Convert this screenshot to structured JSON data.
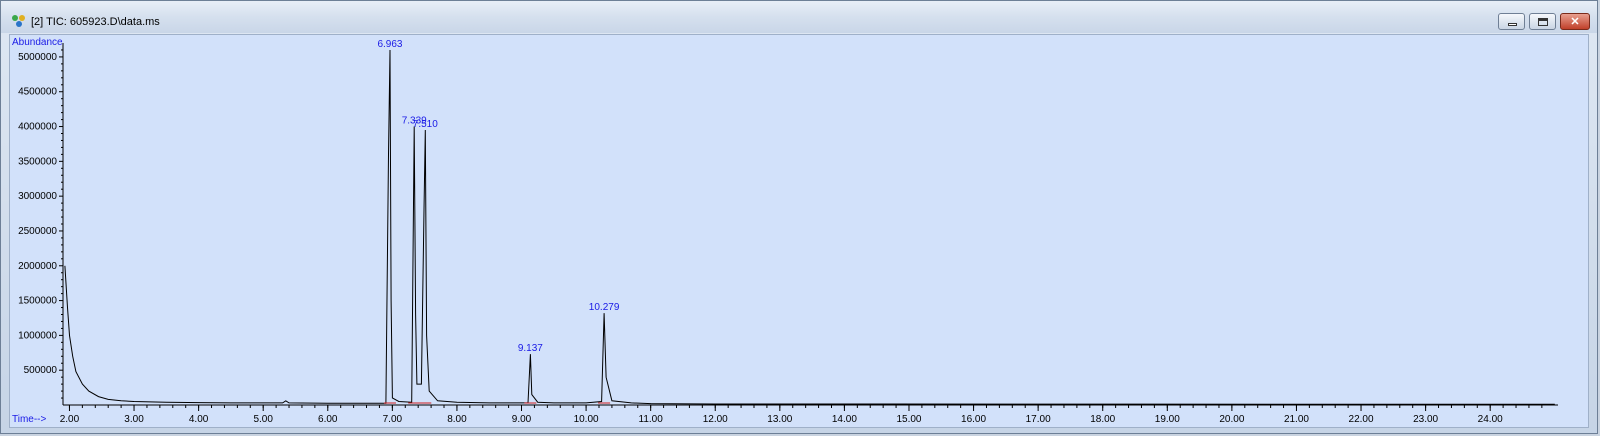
{
  "window": {
    "title": "[2] TIC: 605923.D\\data.ms",
    "icon": "chromatogram-app-icon",
    "buttons": [
      "minimize-icon",
      "maximize-icon",
      "close-icon"
    ]
  },
  "chart_data": {
    "type": "line",
    "title": "",
    "xlabel": "Time-->",
    "ylabel": "Abundance",
    "xlim": [
      1.9,
      25.05
    ],
    "ylim": [
      0,
      5200000
    ],
    "x_ticks": [
      "2.00",
      "3.00",
      "4.00",
      "5.00",
      "6.00",
      "7.00",
      "8.00",
      "9.00",
      "10.00",
      "11.00",
      "12.00",
      "13.00",
      "14.00",
      "15.00",
      "16.00",
      "17.00",
      "18.00",
      "19.00",
      "20.00",
      "21.00",
      "22.00",
      "23.00",
      "24.00"
    ],
    "y_ticks": [
      "500000",
      "1000000",
      "1500000",
      "2000000",
      "2500000",
      "3000000",
      "3500000",
      "4000000",
      "4500000",
      "5000000"
    ],
    "series": [
      {
        "x": [
          1.93,
          1.97,
          2.0,
          2.05,
          2.1,
          2.2,
          2.3,
          2.45,
          2.6,
          2.8,
          3.0,
          3.5,
          4.0,
          4.5,
          5.0,
          5.3,
          5.35,
          5.4,
          6.0,
          6.9,
          6.94,
          6.963,
          6.98,
          7.0,
          7.1,
          7.3,
          7.339,
          7.36,
          7.38,
          7.45,
          7.49,
          7.51,
          7.53,
          7.57,
          7.7,
          8.0,
          8.5,
          9.0,
          9.1,
          9.137,
          9.16,
          9.25,
          9.5,
          10.0,
          10.24,
          10.279,
          10.31,
          10.4,
          10.7,
          11.0,
          12.0,
          25.0
        ],
        "y": [
          2000000,
          1400000,
          1000000,
          700000,
          480000,
          300000,
          200000,
          120000,
          80000,
          60000,
          50000,
          40000,
          35000,
          30000,
          30000,
          30000,
          60000,
          30000,
          25000,
          25000,
          3600000,
          5100000,
          1500000,
          100000,
          50000,
          40000,
          4000000,
          1300000,
          300000,
          300000,
          2800000,
          3950000,
          1000000,
          200000,
          60000,
          40000,
          30000,
          30000,
          30000,
          730000,
          150000,
          40000,
          30000,
          30000,
          50000,
          1320000,
          400000,
          60000,
          30000,
          20000,
          15000,
          10000
        ]
      }
    ],
    "peak_labels": [
      {
        "x": 6.963,
        "y": 5100000,
        "text": "6.963"
      },
      {
        "x": 7.339,
        "y": 4000000,
        "text": "7.339"
      },
      {
        "x": 7.51,
        "y": 3950000,
        "text": "7.510"
      },
      {
        "x": 9.137,
        "y": 730000,
        "text": "9.137"
      },
      {
        "x": 10.279,
        "y": 1320000,
        "text": "10.279"
      }
    ],
    "colors": {
      "trace": "#000000",
      "labels": "#1a1ae6",
      "baseline_marks": "#d02020",
      "background": "#d2e1fa"
    }
  }
}
